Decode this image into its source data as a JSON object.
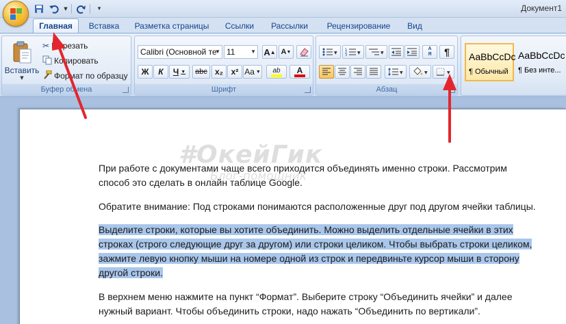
{
  "window": {
    "title": "Документ1"
  },
  "quick_access": {
    "icons": [
      "save-icon",
      "undo-icon",
      "redo-icon",
      "customize-icon"
    ]
  },
  "tabs": [
    {
      "label": "Главная",
      "active": true
    },
    {
      "label": "Вставка"
    },
    {
      "label": "Разметка страницы"
    },
    {
      "label": "Ссылки"
    },
    {
      "label": "Рассылки"
    },
    {
      "label": "Рецензирование"
    },
    {
      "label": "Вид"
    }
  ],
  "clipboard": {
    "label": "Буфер обмена",
    "paste_label": "Вставить",
    "cut_label": "Вырезать",
    "copy_label": "Копировать",
    "format_painter_label": "Формат по образцу"
  },
  "font": {
    "label": "Шрифт",
    "font_name": "Calibri (Основной те",
    "font_size": "11",
    "grow_label": "A",
    "shrink_label": "A",
    "bold_label": "Ж",
    "italic_label": "К",
    "underline_label": "Ч",
    "strike_label": "abc",
    "subscript_label": "x₂",
    "superscript_label": "x²",
    "case_label": "Aa",
    "highlight_label": "ab",
    "color_label": "A"
  },
  "paragraph": {
    "label": "Абзац",
    "sort_label": "А Я",
    "pilcrow_label": "¶"
  },
  "styles": {
    "items": [
      {
        "sample": "AaBbCcDc",
        "name": "¶ Обычный"
      },
      {
        "sample": "AaBbCcDc",
        "name": "¶ Без инте..."
      }
    ]
  },
  "watermark": {
    "title": "#ОкейГик",
    "subtitle": "Блог-помощник"
  },
  "document": {
    "p1": "При работе с документами чаще всего приходится объединять именно строки. Рассмотрим способ это сделать в онлайн таблице Google.",
    "p2": "Обратите внимание: Под строками понимаются расположенные друг под другом ячейки таблицы.",
    "p3": "Выделите строки, которые вы хотите объединить. Можно выделить отдельные ячейки в этих строках (строго следующие друг за другом) или строки целиком. Чтобы выбрать строки целиком, зажмите левую кнопку мыши на номере одной из строк и передвиньте курсор мыши в сторону другой строки.",
    "p4": "В верхнем меню нажмите на пункт “Формат”. Выберите строку “Объединить ячейки” и далее нужный вариант. Чтобы объединить строки, надо нажать “Объединить по вертикали”."
  },
  "colors": {
    "arrow": "#e3262d",
    "highlight": "#a9c6eb",
    "ribbon_text": "#15428b"
  }
}
